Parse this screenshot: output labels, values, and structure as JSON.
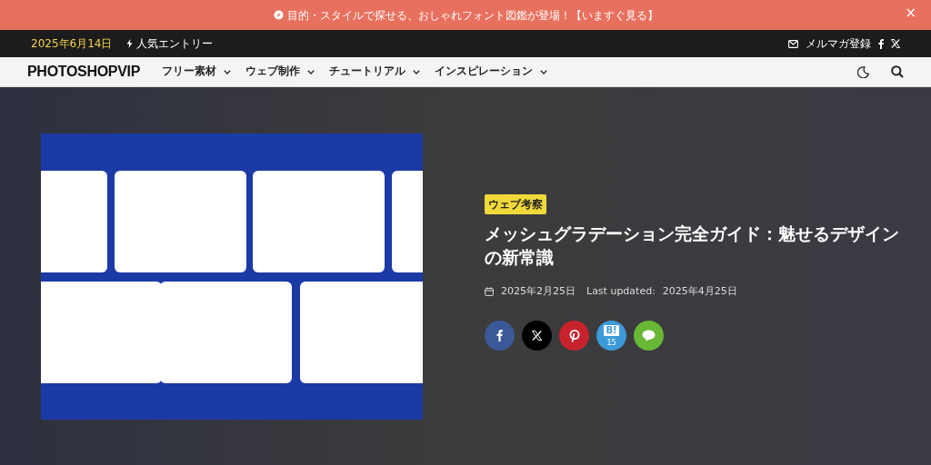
{
  "announcement": {
    "text": "目的・スタイルで探せる、おしゃれフォント図鑑が登場！【いますぐ見る】",
    "close": "×"
  },
  "top_bar": {
    "date": "2025年6月14日",
    "popular": "人気エントリー",
    "newsletter": "メルマガ登録"
  },
  "nav": {
    "logo": "PHOTOSHOPVIP",
    "items": [
      {
        "label": "フリー素材"
      },
      {
        "label": "ウェブ制作"
      },
      {
        "label": "チュートリアル"
      },
      {
        "label": "インスピレーション"
      }
    ]
  },
  "article": {
    "category": "ウェブ考察",
    "title": "メッシュグラデーション完全ガイド：魅せるデザインの新常識",
    "published": "2025年2月25日",
    "updated_label": "Last updated:",
    "updated": "2025年4月25日",
    "share": [
      {
        "kind": "facebook"
      },
      {
        "kind": "x"
      },
      {
        "kind": "pinterest"
      },
      {
        "kind": "hatena",
        "label": "B!",
        "count": "15"
      },
      {
        "kind": "line"
      }
    ]
  }
}
